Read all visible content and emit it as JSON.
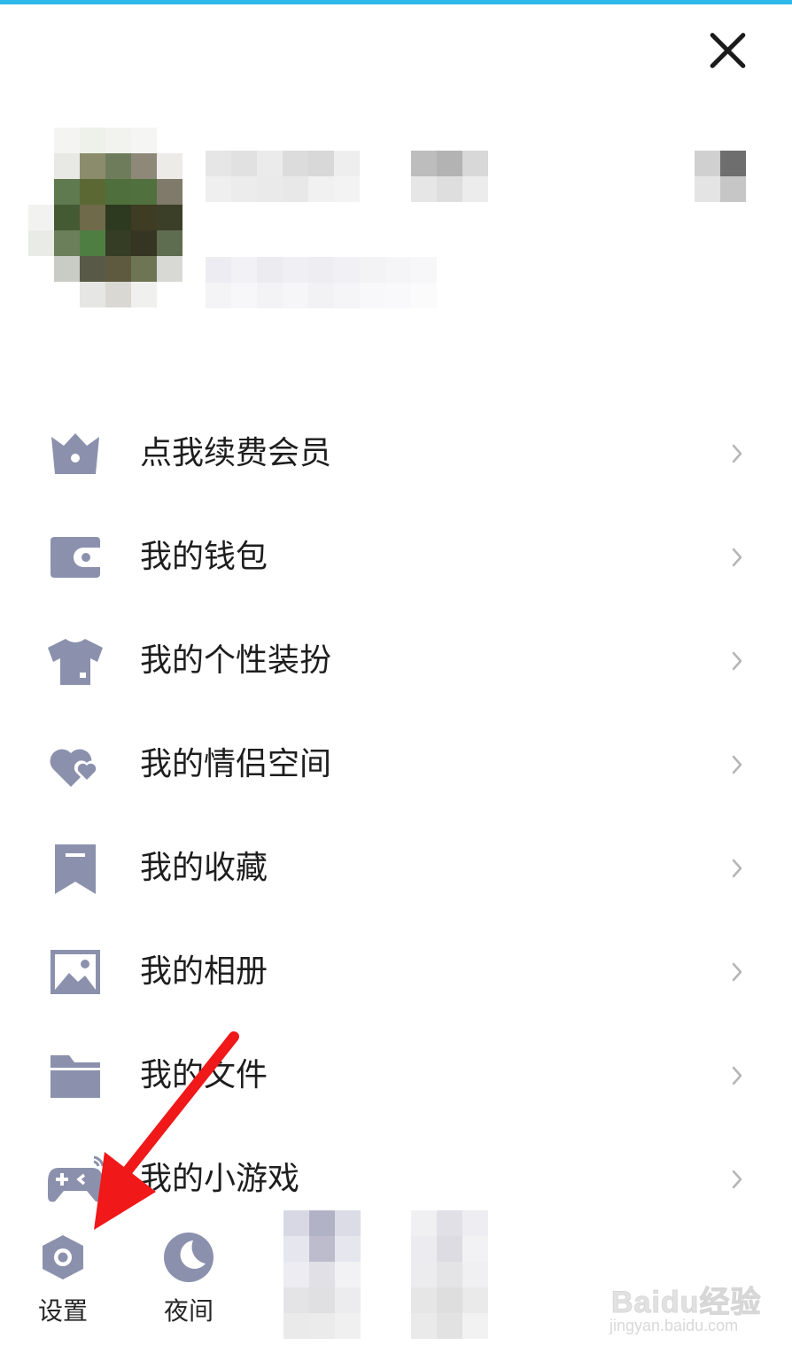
{
  "menu": {
    "items": [
      {
        "label": "点我续费会员",
        "icon": "crown-icon"
      },
      {
        "label": "我的钱包",
        "icon": "wallet-icon"
      },
      {
        "label": "我的个性装扮",
        "icon": "shirt-icon"
      },
      {
        "label": "我的情侣空间",
        "icon": "hearts-icon"
      },
      {
        "label": "我的收藏",
        "icon": "bookmark-icon"
      },
      {
        "label": "我的相册",
        "icon": "photo-icon"
      },
      {
        "label": "我的文件",
        "icon": "folder-icon"
      },
      {
        "label": "我的小游戏",
        "icon": "gamepad-icon"
      }
    ]
  },
  "bottom": {
    "settings_label": "设置",
    "night_label": "夜间"
  },
  "watermark": {
    "main": "Baidu经验",
    "sub": "jingyan.baidu.com"
  },
  "colors": {
    "accent_top": "#2fb9ea",
    "icon": "#8b91ad",
    "arrow": "#f01818"
  }
}
